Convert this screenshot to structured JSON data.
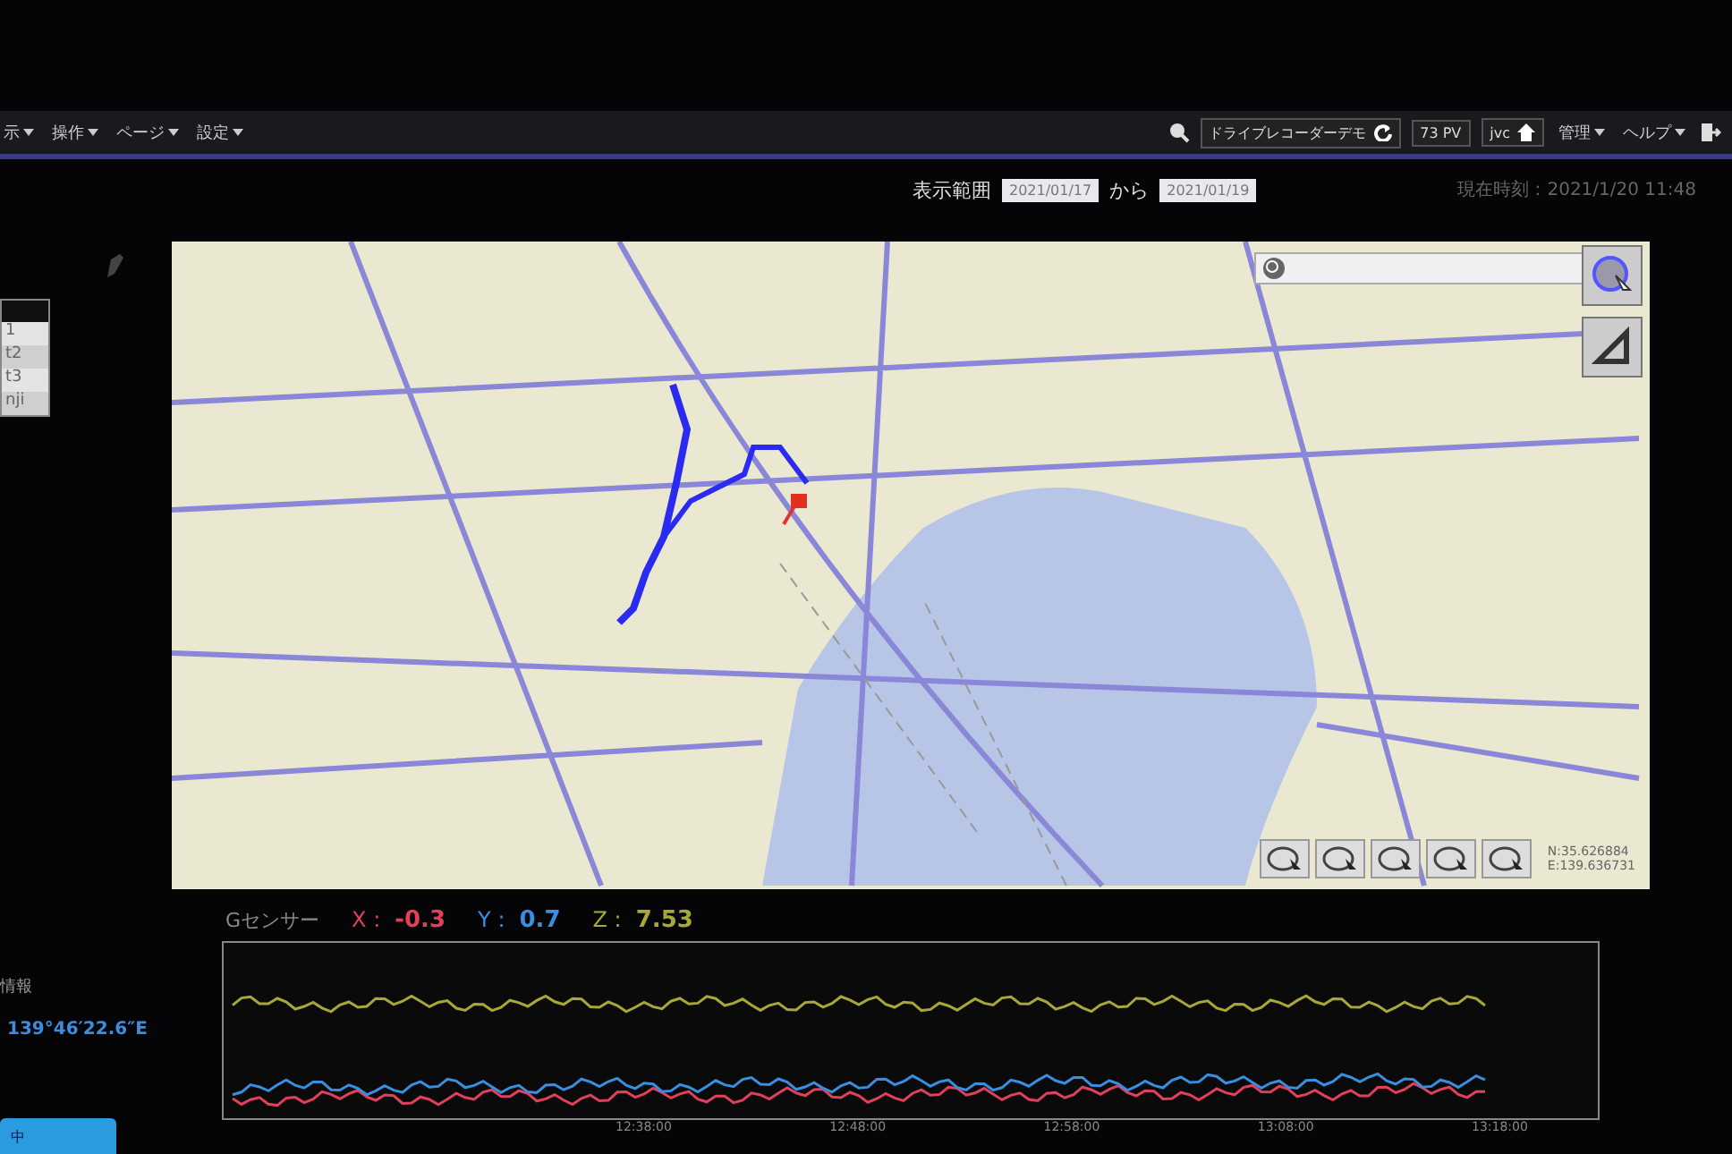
{
  "menu": {
    "items": [
      "示",
      "操作",
      "ページ",
      "設定"
    ]
  },
  "header": {
    "site": "ドライブレコーダーデモ",
    "views": "73 PV",
    "user": "jvc",
    "links": [
      "管理",
      "ヘルプ"
    ]
  },
  "date_range": {
    "label": "表示範囲",
    "from": "2021/01/17",
    "separator": "から",
    "to": "2021/01/19"
  },
  "current_time": "現在時刻：2021/1/20 11:48",
  "sidebar": {
    "items": [
      "1",
      "t2",
      "t3",
      "nji"
    ],
    "location_label": "情報",
    "longitude": "139°46′22.6″E",
    "button": "中"
  },
  "map": {
    "coordinates": [
      "N:35.626884",
      "E:139.636731"
    ]
  },
  "gsensor": {
    "label": "Gセンサー",
    "axes": [
      {
        "name": "X :",
        "value": "-0.3",
        "color": "#e0405a"
      },
      {
        "name": "Y :",
        "value": "0.7",
        "color": "#3a8ee0"
      },
      {
        "name": "Z :",
        "value": "7.53",
        "color": "#a8a838"
      }
    ],
    "time_labels": [
      "12:38:00",
      "12:48:00",
      "12:58:00",
      "13:08:00",
      "13:18:00"
    ]
  }
}
